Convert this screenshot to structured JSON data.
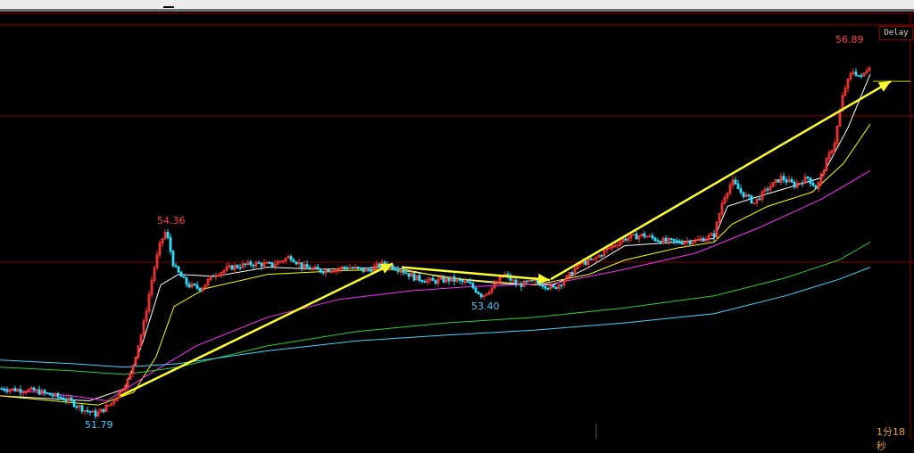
{
  "header": {
    "delay_label": "Delay"
  },
  "footer": {
    "time_label": "1分18秒"
  },
  "colors": {
    "up": "#ff3838",
    "down": "#30e0ff",
    "ma_white": "#ffffff",
    "ma_yellow": "#ffff00",
    "ma_magenta": "#ff30ff",
    "ma_green": "#30d030",
    "ma_cyan": "#40d8ff",
    "arrow": "#ffff30",
    "grid": "#8a0000",
    "high_label": "#ff4040",
    "low_label": "#40d0ff"
  },
  "chart_data": {
    "type": "candlestick",
    "title": "",
    "xlabel": "",
    "ylabel": "",
    "ylim": [
      51.5,
      57.3
    ],
    "grid": "horizontal",
    "annotations": {
      "high_1": "54.36",
      "high_2": "56.89",
      "low_1": "53.40",
      "low_2": "51.79"
    },
    "price_path": [
      [
        0,
        52.15
      ],
      [
        40,
        52.12
      ],
      [
        75,
        52.0
      ],
      [
        95,
        51.85
      ],
      [
        108,
        51.79
      ],
      [
        125,
        51.95
      ],
      [
        145,
        52.3
      ],
      [
        160,
        53.0
      ],
      [
        172,
        53.8
      ],
      [
        180,
        54.2
      ],
      [
        186,
        54.36
      ],
      [
        195,
        53.85
      ],
      [
        210,
        53.6
      ],
      [
        225,
        53.55
      ],
      [
        240,
        53.75
      ],
      [
        260,
        53.85
      ],
      [
        285,
        53.9
      ],
      [
        305,
        53.88
      ],
      [
        325,
        54.0
      ],
      [
        340,
        53.85
      ],
      [
        360,
        53.8
      ],
      [
        390,
        53.85
      ],
      [
        410,
        53.8
      ],
      [
        430,
        53.9
      ],
      [
        448,
        53.82
      ],
      [
        465,
        53.7
      ],
      [
        485,
        53.65
      ],
      [
        505,
        53.68
      ],
      [
        525,
        53.62
      ],
      [
        540,
        53.45
      ],
      [
        555,
        53.6
      ],
      [
        565,
        53.75
      ],
      [
        580,
        53.6
      ],
      [
        600,
        53.65
      ],
      [
        620,
        53.55
      ],
      [
        635,
        53.7
      ],
      [
        650,
        53.9
      ],
      [
        665,
        53.95
      ],
      [
        680,
        54.1
      ],
      [
        700,
        54.25
      ],
      [
        720,
        54.3
      ],
      [
        740,
        54.22
      ],
      [
        760,
        54.2
      ],
      [
        780,
        54.22
      ],
      [
        800,
        54.3
      ],
      [
        810,
        54.8
      ],
      [
        820,
        55.05
      ],
      [
        830,
        54.9
      ],
      [
        845,
        54.75
      ],
      [
        860,
        54.95
      ],
      [
        875,
        55.1
      ],
      [
        890,
        55.0
      ],
      [
        905,
        55.1
      ],
      [
        915,
        54.95
      ],
      [
        925,
        55.3
      ],
      [
        935,
        55.6
      ],
      [
        945,
        56.3
      ],
      [
        955,
        56.6
      ],
      [
        965,
        56.5
      ],
      [
        975,
        56.7
      ]
    ],
    "series": [
      {
        "color": "white",
        "points": [
          [
            0,
            52.05
          ],
          [
            100,
            51.98
          ],
          [
            140,
            52.15
          ],
          [
            160,
            52.8
          ],
          [
            180,
            53.6
          ],
          [
            200,
            53.75
          ],
          [
            240,
            53.72
          ],
          [
            300,
            53.85
          ],
          [
            360,
            53.82
          ],
          [
            440,
            53.85
          ],
          [
            500,
            53.7
          ],
          [
            560,
            53.62
          ],
          [
            620,
            53.6
          ],
          [
            660,
            53.85
          ],
          [
            700,
            54.15
          ],
          [
            760,
            54.2
          ],
          [
            800,
            54.25
          ],
          [
            815,
            54.7
          ],
          [
            840,
            54.8
          ],
          [
            880,
            54.95
          ],
          [
            920,
            55.1
          ],
          [
            950,
            55.8
          ],
          [
            975,
            56.55
          ]
        ]
      },
      {
        "color": "yellow",
        "points": [
          [
            0,
            52.05
          ],
          [
            110,
            51.92
          ],
          [
            150,
            52.1
          ],
          [
            175,
            52.6
          ],
          [
            195,
            53.3
          ],
          [
            230,
            53.55
          ],
          [
            300,
            53.75
          ],
          [
            380,
            53.8
          ],
          [
            440,
            53.82
          ],
          [
            520,
            53.68
          ],
          [
            600,
            53.6
          ],
          [
            660,
            53.75
          ],
          [
            700,
            53.95
          ],
          [
            760,
            54.12
          ],
          [
            800,
            54.2
          ],
          [
            820,
            54.45
          ],
          [
            860,
            54.7
          ],
          [
            910,
            54.9
          ],
          [
            945,
            55.3
          ],
          [
            975,
            55.85
          ]
        ]
      },
      {
        "color": "magenta",
        "points": [
          [
            0,
            52.15
          ],
          [
            80,
            52.05
          ],
          [
            120,
            51.98
          ],
          [
            160,
            52.3
          ],
          [
            220,
            52.75
          ],
          [
            300,
            53.15
          ],
          [
            380,
            53.4
          ],
          [
            460,
            53.52
          ],
          [
            530,
            53.58
          ],
          [
            620,
            53.62
          ],
          [
            700,
            53.82
          ],
          [
            780,
            54.05
          ],
          [
            850,
            54.4
          ],
          [
            920,
            54.8
          ],
          [
            975,
            55.2
          ]
        ]
      },
      {
        "color": "green",
        "points": [
          [
            0,
            52.45
          ],
          [
            80,
            52.4
          ],
          [
            140,
            52.35
          ],
          [
            200,
            52.45
          ],
          [
            300,
            52.75
          ],
          [
            400,
            52.95
          ],
          [
            500,
            53.07
          ],
          [
            600,
            53.15
          ],
          [
            700,
            53.28
          ],
          [
            800,
            53.45
          ],
          [
            880,
            53.7
          ],
          [
            940,
            53.95
          ],
          [
            975,
            54.2
          ]
        ]
      },
      {
        "color": "cyan",
        "points": [
          [
            0,
            52.55
          ],
          [
            80,
            52.5
          ],
          [
            140,
            52.45
          ],
          [
            200,
            52.5
          ],
          [
            300,
            52.68
          ],
          [
            400,
            52.82
          ],
          [
            500,
            52.9
          ],
          [
            600,
            52.97
          ],
          [
            700,
            53.07
          ],
          [
            800,
            53.2
          ],
          [
            880,
            53.45
          ],
          [
            940,
            53.68
          ],
          [
            975,
            53.85
          ]
        ]
      }
    ],
    "arrows": [
      [
        [
          135,
          52.05
        ],
        [
          440,
          53.9
        ]
      ],
      [
        [
          450,
          53.85
        ],
        [
          616,
          53.67
        ]
      ],
      [
        [
          617,
          53.68
        ],
        [
          998,
          56.45
        ]
      ]
    ],
    "reference_lines": [
      56.45
    ]
  }
}
